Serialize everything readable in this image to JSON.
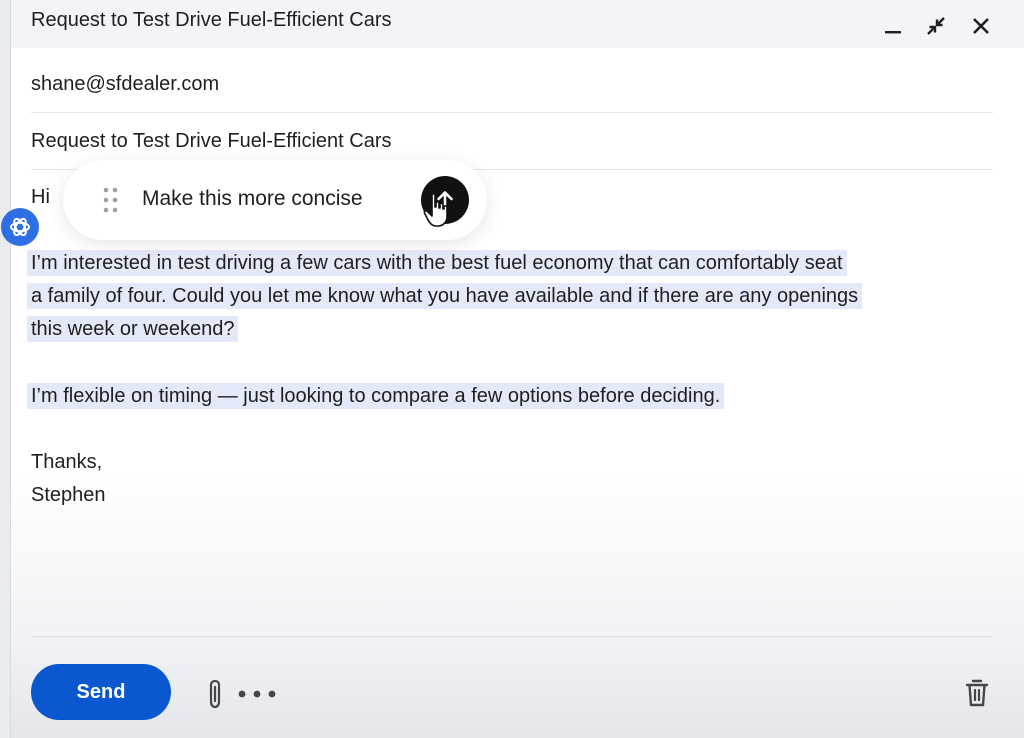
{
  "window": {
    "title": "Request to Test Drive Fuel-Efficient Cars",
    "controls": {
      "minimize_icon": "minimize-icon",
      "collapse_icon": "collapse-icon",
      "close_icon": "close-icon"
    }
  },
  "compose": {
    "to": "shane@sfdealer.com",
    "subject": "Request to Test Drive Fuel-Efficient Cars",
    "greeting": "Hi",
    "paragraph1_lines": [
      "I’m interested in test driving a few cars with the best fuel economy that can comfortably seat",
      "a family of four. Could you let me know what you have available and if there are any openings",
      "this week or weekend?"
    ],
    "paragraph2": "I’m flexible on timing — just looking to compare a few options before deciding.",
    "signoff": "Thanks,",
    "signature": "Stephen"
  },
  "ai_prompt": {
    "text": "Make this more concise",
    "submit_icon": "arrow-up-icon"
  },
  "footer": {
    "send_label": "Send"
  },
  "colors": {
    "accent": "#0b57d0",
    "highlight": "#e3e9f8",
    "badge": "#2f6fe4"
  }
}
